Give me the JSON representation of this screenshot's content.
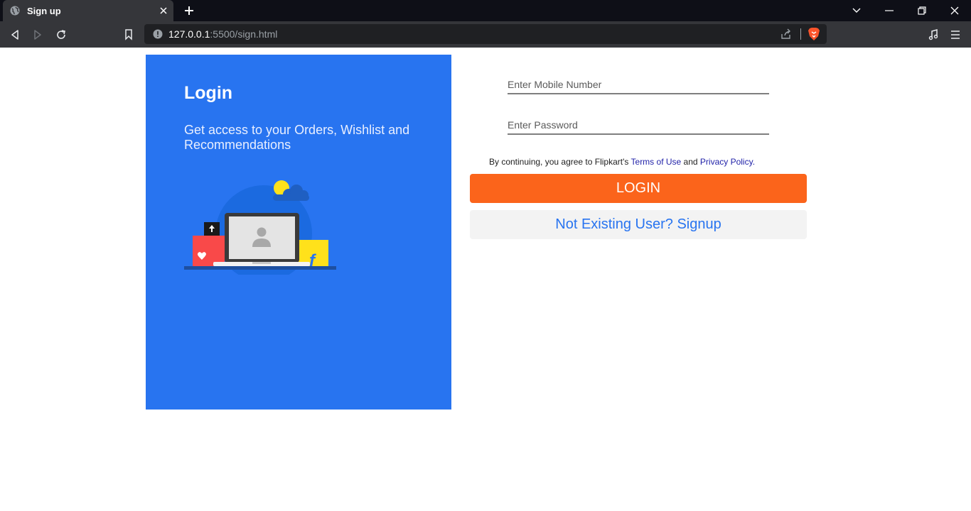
{
  "browser": {
    "tab_title": "Sign up",
    "url_host": "127.0.0.1",
    "url_path": ":5500/sign.html"
  },
  "left_panel": {
    "title": "Login",
    "subtitle": "Get access to your Orders, Wishlist and Recommendations",
    "bg_color": "#2874f0"
  },
  "form": {
    "mobile_placeholder": "Enter Mobile Number",
    "password_placeholder": "Enter Password",
    "terms_prefix": "By continuing, you agree to Flipkart's ",
    "terms_link": "Terms of Use",
    "terms_and": " and ",
    "privacy_link": "Privacy Policy.",
    "login_label": "LOGIN",
    "login_color": "#fb641b",
    "signup_label": "Not Existing User? Signup"
  }
}
